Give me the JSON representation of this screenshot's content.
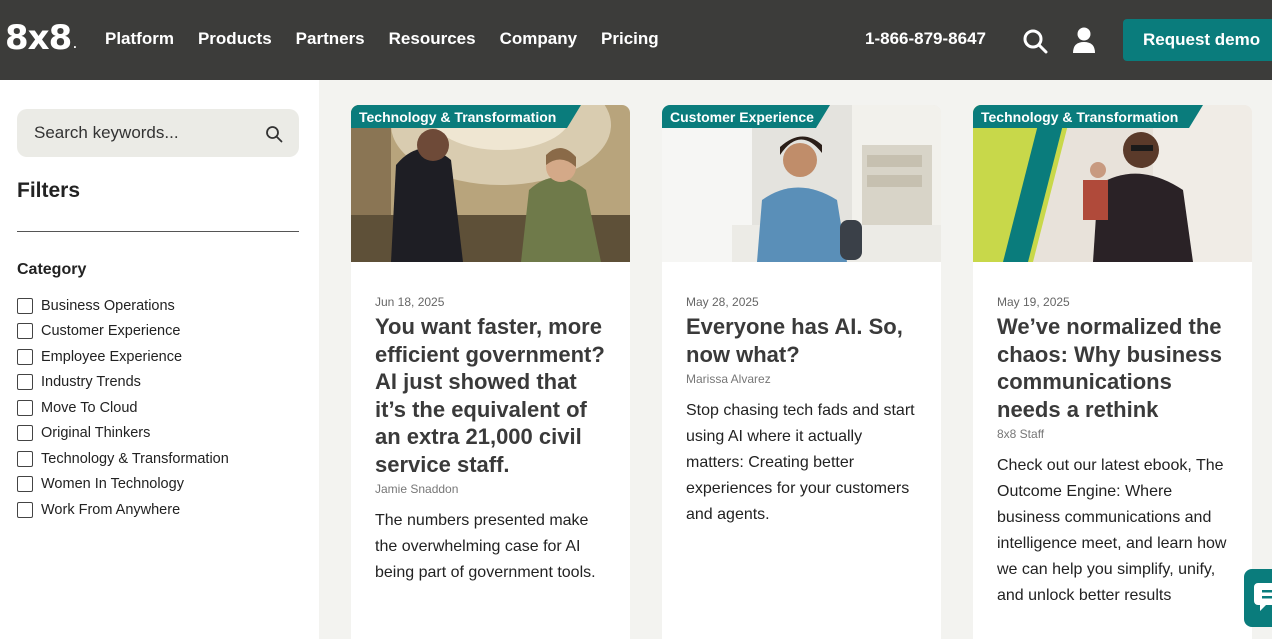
{
  "header": {
    "logo": "8x8",
    "logo_mark": ".",
    "nav": [
      "Platform",
      "Products",
      "Partners",
      "Resources",
      "Company",
      "Pricing"
    ],
    "phone": "1-866-879-8647",
    "demo_label": "Request demo"
  },
  "sidebar": {
    "search_placeholder": "Search keywords...",
    "filters_title": "Filters",
    "category_title": "Category",
    "categories": [
      "Business Operations",
      "Customer Experience",
      "Employee Experience",
      "Industry Trends",
      "Move To Cloud",
      "Original Thinkers",
      "Technology & Transformation",
      "Women In Technology",
      "Work From Anywhere"
    ]
  },
  "cards": [
    {
      "tag": "Technology & Transformation",
      "date": "Jun 18, 2025",
      "title": "You want faster, more efficient government? AI just showed that it’s the equivalent of an extra 21,000 civil service staff.",
      "author": "Jamie Snaddon",
      "desc": "The numbers presented make the overwhelming case for AI being part of government tools."
    },
    {
      "tag": "Customer Experience",
      "date": "May 28, 2025",
      "title": "Everyone has AI. So, now what?",
      "author": "Marissa Alvarez",
      "desc": "Stop chasing tech fads and start using AI where it actually matters: Creating better experiences for your customers and agents."
    },
    {
      "tag": "Technology & Transformation",
      "date": "May 19, 2025",
      "title": "We’ve normalized the chaos: Why business communications needs a rethink",
      "author": "8x8 Staff",
      "desc": "Check out our latest ebook, The Outcome Engine: Where business communications and intelligence meet, and learn how we can help you simplify, unify, and unlock better results"
    }
  ],
  "colors": {
    "accent": "#0a7c7c",
    "header_bg": "#3c3c3a",
    "page_bg": "#f3f3f0"
  }
}
